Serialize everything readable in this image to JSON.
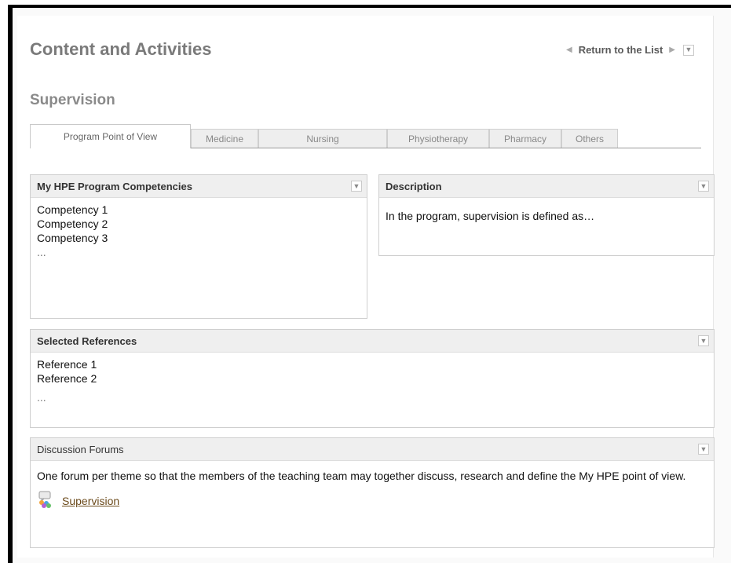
{
  "header": {
    "title": "Content and Activities",
    "return_label": "Return to the List"
  },
  "section": {
    "title": "Supervision"
  },
  "tabs": [
    {
      "label": "Program Point of View",
      "active": true
    },
    {
      "label": "Medicine"
    },
    {
      "label": "Nursing"
    },
    {
      "label": "Physiotherapy"
    },
    {
      "label": "Pharmacy"
    },
    {
      "label": "Others"
    }
  ],
  "panels": {
    "competencies": {
      "title": "My HPE Program Competencies",
      "items": [
        "Competency 1",
        "Competency 2",
        "Competency 3"
      ],
      "more": "..."
    },
    "description": {
      "title": "Description",
      "text": "In the program, supervision is defined as…"
    },
    "references": {
      "title": "Selected References",
      "items": [
        "Reference 1",
        "Reference 2"
      ],
      "more": "..."
    },
    "forums": {
      "title": "Discussion Forums",
      "text": "One forum per theme so that the members of the teaching team may together discuss, research and define the My HPE point of view.",
      "link_label": "Supervision"
    }
  },
  "colors": {
    "title_gray": "#7a7a7a",
    "link_brown": "#6b4a1b",
    "panel_header_bg": "#efefef"
  },
  "icons": {
    "dropdown": "chevron-down-icon",
    "forum": "forum-people-icon"
  }
}
